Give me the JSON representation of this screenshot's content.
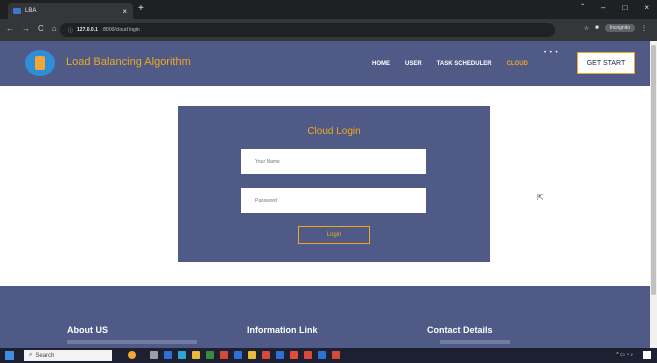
{
  "browser": {
    "tab_title": "LBA",
    "tab_close": "×",
    "new_tab": "+",
    "window_controls": [
      "ˇ",
      "–",
      "□",
      "×"
    ],
    "nav_buttons": [
      "←",
      "→",
      "C",
      "⌂"
    ],
    "address_host": "127.0.0.1",
    "address_path": ":8000/cloud login",
    "incognito_label": "Incognito"
  },
  "site": {
    "brand": "Load Balancing Algorithm",
    "nav": [
      "HOME",
      "USER",
      "TASK SCHEDULER",
      "CLOUD"
    ],
    "nav_active": "CLOUD",
    "dots": "• • •",
    "get_start": "GET START"
  },
  "login": {
    "title": "Cloud Login",
    "username_placeholder": "Your Name",
    "password_placeholder": "Password",
    "button": "Login"
  },
  "footer": {
    "about": "About US",
    "info": "Information Link",
    "contact": "Contact Details"
  },
  "taskbar": {
    "search": "Search"
  },
  "colors": {
    "accent": "#f1a820",
    "panel": "#4f5a86"
  },
  "icons": {
    "logo": "cloud-database-icon",
    "cursor": "pointer-icon"
  }
}
